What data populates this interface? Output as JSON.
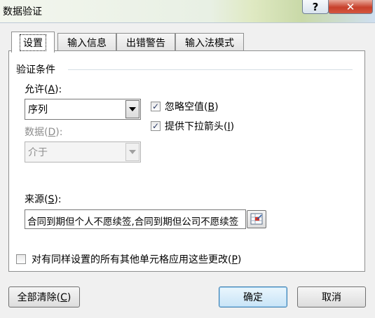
{
  "window": {
    "title": "数据验证",
    "help_label": "?",
    "close_label": "✕"
  },
  "tabs": [
    {
      "label": "设置",
      "active": true
    },
    {
      "label": "输入信息",
      "active": false
    },
    {
      "label": "出错警告",
      "active": false
    },
    {
      "label": "输入法模式",
      "active": false
    }
  ],
  "settings": {
    "group_title": "验证条件",
    "allow": {
      "label": "允许",
      "accel": "A",
      "value": "序列"
    },
    "data": {
      "label": "数据",
      "accel": "D",
      "value": "介于",
      "disabled": true
    },
    "ignore_blank": {
      "label": "忽略空值",
      "accel": "B",
      "checked": true
    },
    "in_cell_dropdown": {
      "label": "提供下拉箭头",
      "accel": "I",
      "checked": true
    },
    "source": {
      "label": "来源",
      "accel": "S",
      "value": "合同到期但个人不愿续签,合同到期但公司不愿续签"
    },
    "apply_all": {
      "label": "对有同样设置的所有其他单元格应用这些更改",
      "accel": "P",
      "checked": false
    }
  },
  "buttons": {
    "clear_all": {
      "label": "全部清除",
      "accel": "C"
    },
    "ok": {
      "label": "确定"
    },
    "cancel": {
      "label": "取消"
    }
  },
  "icons": {
    "checkmark": "✓",
    "collapse_range": "range-select-icon"
  }
}
